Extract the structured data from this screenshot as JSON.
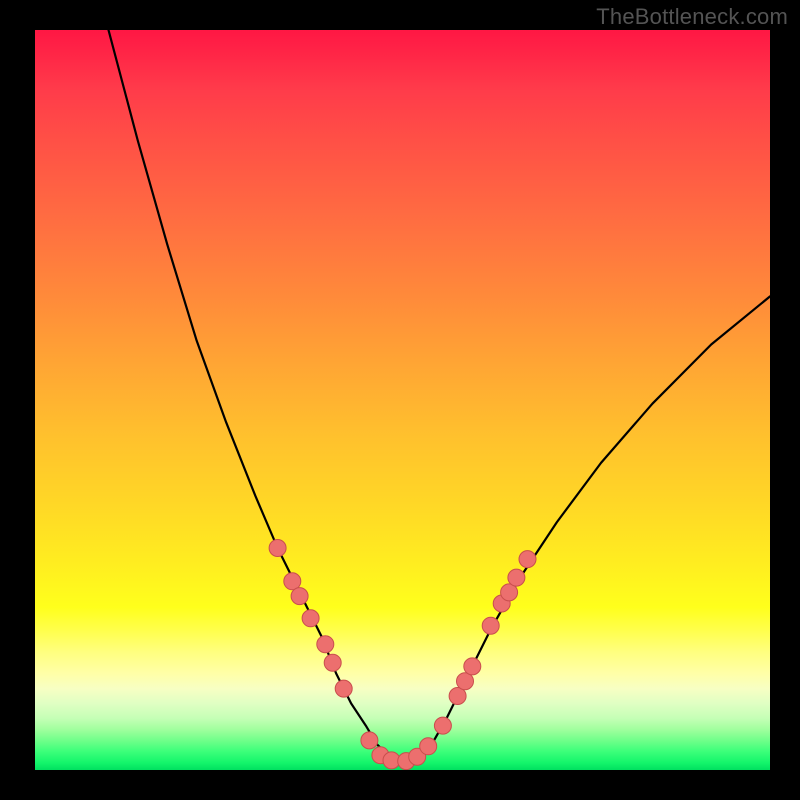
{
  "watermark": "TheBottleneck.com",
  "colors": {
    "curve": "#000000",
    "marker_fill": "#ec6f6e",
    "marker_stroke": "#c94e4d",
    "frame": "#000000"
  },
  "chart_data": {
    "type": "line",
    "title": "",
    "xlabel": "",
    "ylabel": "",
    "xlim": [
      0,
      100
    ],
    "ylim": [
      0,
      100
    ],
    "grid": false,
    "legend": false,
    "series": [
      {
        "name": "bottleneck-curve",
        "x": [
          10,
          14,
          18,
          22,
          26,
          30,
          33,
          36,
          39,
          41,
          43,
          45,
          46.5,
          48,
          49.5,
          51,
          52.5,
          54,
          56,
          59,
          62,
          66,
          71,
          77,
          84,
          92,
          100
        ],
        "y": [
          100,
          85,
          71,
          58,
          47,
          37,
          30,
          24,
          18,
          13,
          9,
          6,
          3.5,
          2,
          1.2,
          1.2,
          2,
          3.5,
          7,
          13,
          19,
          26,
          33.5,
          41.5,
          49.5,
          57.5,
          64
        ]
      }
    ],
    "markers": {
      "name": "sample-points",
      "points": [
        {
          "x": 33.0,
          "y": 30.0
        },
        {
          "x": 35.0,
          "y": 25.5
        },
        {
          "x": 36.0,
          "y": 23.5
        },
        {
          "x": 37.5,
          "y": 20.5
        },
        {
          "x": 39.5,
          "y": 17.0
        },
        {
          "x": 40.5,
          "y": 14.5
        },
        {
          "x": 42.0,
          "y": 11.0
        },
        {
          "x": 45.5,
          "y": 4.0
        },
        {
          "x": 47.0,
          "y": 2.0
        },
        {
          "x": 48.5,
          "y": 1.3
        },
        {
          "x": 50.5,
          "y": 1.2
        },
        {
          "x": 52.0,
          "y": 1.8
        },
        {
          "x": 53.5,
          "y": 3.2
        },
        {
          "x": 55.5,
          "y": 6.0
        },
        {
          "x": 57.5,
          "y": 10.0
        },
        {
          "x": 58.5,
          "y": 12.0
        },
        {
          "x": 59.5,
          "y": 14.0
        },
        {
          "x": 62.0,
          "y": 19.5
        },
        {
          "x": 63.5,
          "y": 22.5
        },
        {
          "x": 64.5,
          "y": 24.0
        },
        {
          "x": 65.5,
          "y": 26.0
        },
        {
          "x": 67.0,
          "y": 28.5
        }
      ]
    }
  }
}
